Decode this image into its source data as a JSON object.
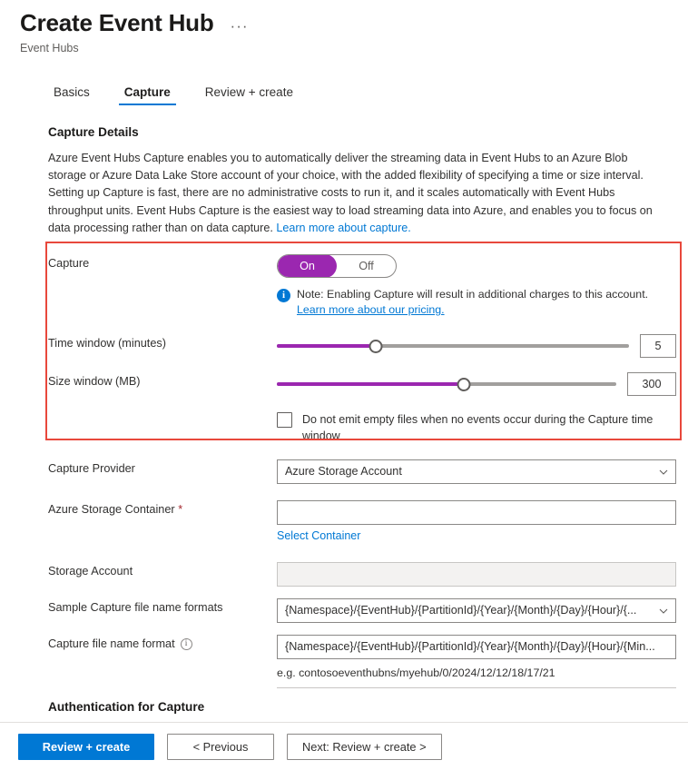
{
  "header": {
    "title": "Create Event Hub",
    "subtitle": "Event Hubs",
    "more_label": "···"
  },
  "tabs": [
    {
      "label": "Basics",
      "active": false
    },
    {
      "label": "Capture",
      "active": true
    },
    {
      "label": "Review + create",
      "active": false
    }
  ],
  "capture_details": {
    "section_title": "Capture Details",
    "description": "Azure Event Hubs Capture enables you to automatically deliver the streaming data in Event Hubs to an Azure Blob storage or Azure Data Lake Store account of your choice, with the added flexibility of specifying a time or size interval. Setting up Capture is fast, there are no administrative costs to run it, and it scales automatically with Event Hubs throughput units. Event Hubs Capture is the easiest way to load streaming data into Azure, and enables you to focus on data processing rather than on data capture. ",
    "description_link": "Learn more about capture."
  },
  "capture_toggle": {
    "label": "Capture",
    "on_label": "On",
    "off_label": "Off",
    "selected": "On",
    "note_text": "Note: Enabling Capture will result in additional charges to this account.",
    "note_link": "Learn more about our pricing.",
    "accent_color": "#9b27b0"
  },
  "time_window": {
    "label": "Time window (minutes)",
    "value": "5",
    "percent": 28
  },
  "size_window": {
    "label": "Size window (MB)",
    "value": "300",
    "percent": 55
  },
  "empty_files": {
    "label": "Do not emit empty files when no events occur during the Capture time window",
    "checked": false
  },
  "capture_provider": {
    "label": "Capture Provider",
    "value": "Azure Storage Account"
  },
  "storage_container": {
    "label": "Azure Storage Container",
    "required_marker": "*",
    "value": "",
    "select_link": "Select Container"
  },
  "storage_account": {
    "label": "Storage Account",
    "value": ""
  },
  "sample_formats": {
    "label": "Sample Capture file name formats",
    "value": "{Namespace}/{EventHub}/{PartitionId}/{Year}/{Month}/{Day}/{Hour}/{..."
  },
  "file_name_format": {
    "label": "Capture file name format",
    "value": "{Namespace}/{EventHub}/{PartitionId}/{Year}/{Month}/{Day}/{Hour}/{Min...",
    "example": "e.g. contosoeventhubns/myehub/0/2024/12/12/18/17/21"
  },
  "auth_section": {
    "title": "Authentication for Capture"
  },
  "footer": {
    "review_create": "Review + create",
    "previous": "< Previous",
    "next": "Next: Review + create >"
  },
  "highlight": {
    "color": "#e8483c"
  }
}
